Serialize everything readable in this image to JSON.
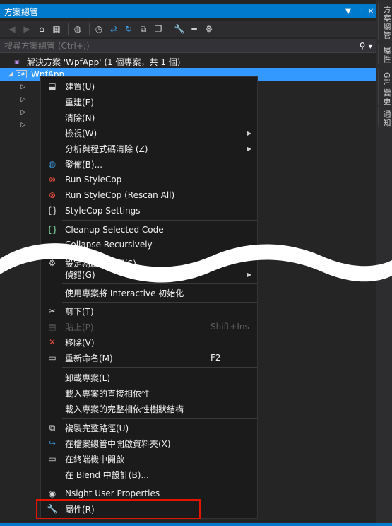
{
  "panel": {
    "title": "方案總管"
  },
  "search": {
    "placeholder": "搜尋方案總管 (Ctrl+;)"
  },
  "tree": {
    "solution_label": "解決方案 'WpfApp' (1 個專案，共 1 個)",
    "project_label": "WpfApp"
  },
  "right_tabs": [
    "方案總管",
    "屬性",
    "Git 變更",
    "通知"
  ],
  "menu": {
    "build": "建置(U)",
    "rebuild": "重建(E)",
    "clean": "清除(N)",
    "view": "檢視(W)",
    "analyze": "分析與程式碼清除 (Z)",
    "publish": "發佈(B)...",
    "run_stylecop": "Run StyleCop",
    "run_stylecop_rescan": "Run StyleCop (Rescan All)",
    "stylecop_settings": "StyleCop Settings",
    "cleanup": "Cleanup Selected Code",
    "collapse": "Collapse Recursively",
    "set_startup": "設定為啟始專案(S)",
    "debug": "偵錯(G)",
    "interactive": "使用專案將 Interactive 初始化",
    "cut": "剪下(T)",
    "paste": "貼上(P)",
    "paste_key": "Shift+Ins",
    "remove": "移除(V)",
    "rename": "重新命名(M)",
    "rename_key": "F2",
    "unload": "卸載專案(L)",
    "load_direct": "載入專案的直接相依性",
    "load_full": "載入專案的完整相依性樹狀結構",
    "copy_path": "複製完整路徑(U)",
    "open_folder": "在檔案總管中開啟資料夾(X)",
    "open_terminal": "在終端機中開啟",
    "design_blend": "在 Blend 中設計(B)...",
    "nsight": "Nsight User Properties",
    "properties": "屬性(R)"
  },
  "colors": {
    "accent": "#007acc",
    "selection": "#3399ff",
    "highlight_box": "#e51400"
  }
}
